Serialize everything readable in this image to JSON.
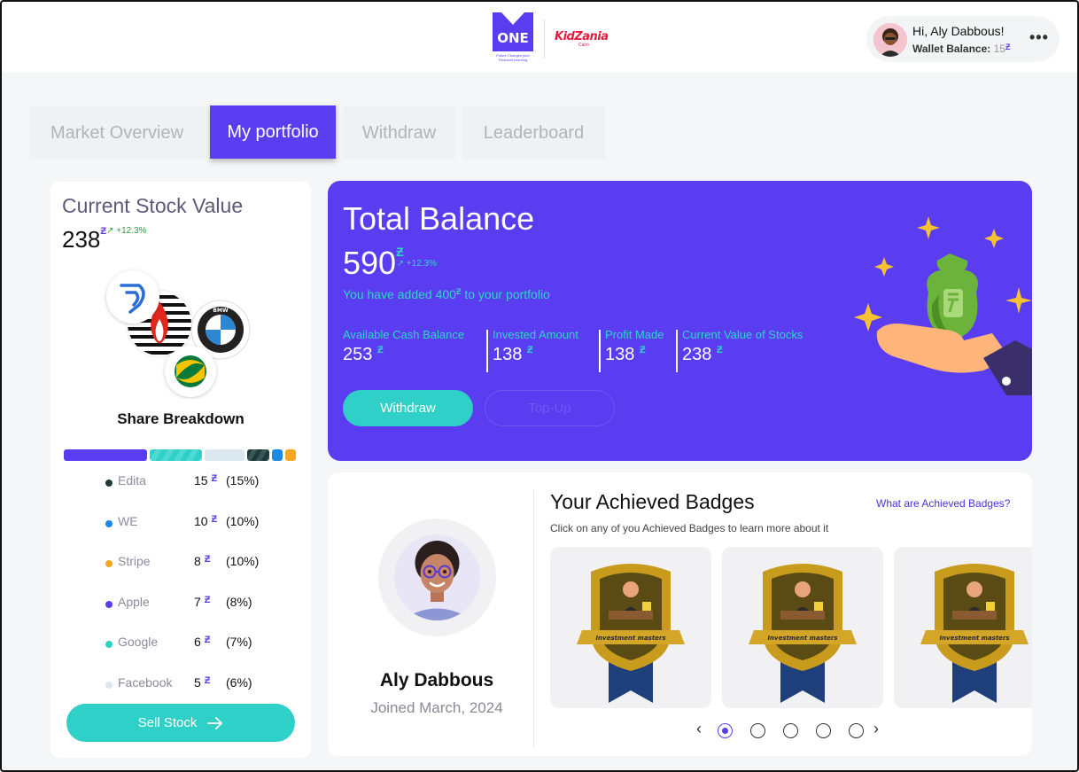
{
  "header": {
    "logo_one": "ONE",
    "logo_one_top": "EFG HERMES",
    "logo_kidzania": "KidZania",
    "logo_kidzania_sub": "Cairo",
    "greeting": "Hi, Aly Dabbous!",
    "wallet_label": "Wallet Balance:",
    "wallet_value": "15",
    "more_icon": "more-dots-icon"
  },
  "tabs": [
    {
      "label": "Market Overview",
      "active": false
    },
    {
      "label": "My portfolio",
      "active": true
    },
    {
      "label": "Withdraw",
      "active": false
    },
    {
      "label": "Leaderboard",
      "active": false
    }
  ],
  "current_stock": {
    "title": "Current Stock Value",
    "value": "238",
    "change": "↗ +12.3%"
  },
  "share_breakdown": {
    "title": "Share Breakdown",
    "items": [
      {
        "name": "Edita",
        "value": "15",
        "pct": "(15%)",
        "color": "#1f3a3a"
      },
      {
        "name": "WE",
        "value": "10",
        "pct": "(10%)",
        "color": "#1e88e5"
      },
      {
        "name": "Stripe",
        "value": "8",
        "pct": "(10%)",
        "color": "#f5a623"
      },
      {
        "name": "Apple",
        "value": "7",
        "pct": "(8%)",
        "color": "#5a3df0"
      },
      {
        "name": "Google",
        "value": "6",
        "pct": "(7%)",
        "color": "#2fd0c8"
      },
      {
        "name": "Facebook",
        "value": "5",
        "pct": "(6%)",
        "color": "#dbe8f0"
      }
    ],
    "sell_label": "Sell Stock"
  },
  "total_balance": {
    "title": "Total Balance",
    "value": "590",
    "change": "↗ +12.3%",
    "added_prefix": "You have added 400",
    "added_suffix": " to your portfolio",
    "stats": [
      {
        "label": "Available Cash Balance",
        "value": "253"
      },
      {
        "label": "Invested Amount",
        "value": "138"
      },
      {
        "label": "Profit Made",
        "value": "138"
      },
      {
        "label": "Current Value of Stocks",
        "value": "238"
      }
    ],
    "withdraw_label": "Withdraw",
    "topup_label": "Top-Up"
  },
  "profile": {
    "name": "Aly Dabbous",
    "joined": "Joined March, 2024"
  },
  "badges": {
    "title": "Your Achieved Badges",
    "subtitle": "Click on any of you Achieved Badges to learn more about it",
    "link": "What are Achieved Badges?",
    "badge_label": "Investment masters",
    "carousel_pages": 5,
    "active_page": 1
  },
  "currency_symbol": "Ƶ",
  "colors": {
    "primary": "#5a3df0",
    "accent": "#2fd0c8",
    "positive": "#2d9b3a"
  }
}
